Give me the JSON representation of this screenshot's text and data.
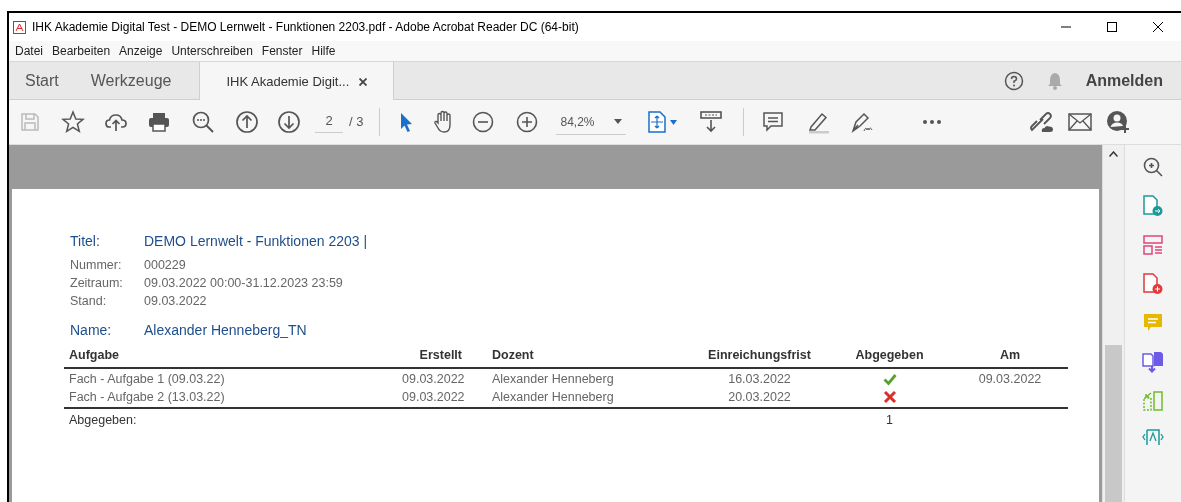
{
  "window": {
    "title": "IHK Akademie Digital Test - DEMO Lernwelt - Funktionen 2203.pdf - Adobe Acrobat Reader DC (64-bit)"
  },
  "menu": [
    "Datei",
    "Bearbeiten",
    "Anzeige",
    "Unterschreiben",
    "Fenster",
    "Hilfe"
  ],
  "tabs": [
    {
      "label": "Start",
      "selected": false,
      "closable": false
    },
    {
      "label": "Werkzeuge",
      "selected": false,
      "closable": false
    },
    {
      "label": "IHK Akademie Digit...",
      "selected": true,
      "closable": true
    }
  ],
  "sign_in": "Anmelden",
  "toolbar": {
    "page_current": "2",
    "page_total": "/ 3",
    "zoom": "84,2%"
  },
  "document": {
    "title_label": "Titel:",
    "title_value": "DEMO Lernwelt - Funktionen 2203 |",
    "fields": [
      {
        "label": "Nummer:",
        "value": "000229"
      },
      {
        "label": "Zeitraum:",
        "value": "09.03.2022 00:00-31.12.2023 23:59"
      },
      {
        "label": "Stand:",
        "value": "09.03.2022"
      }
    ],
    "name_label": "Name:",
    "name_value": "Alexander Henneberg_TN",
    "table": {
      "columns": [
        "Aufgabe",
        "Erstellt",
        "Dozent",
        "Einreichungsfrist",
        "Abgegeben",
        "Am"
      ],
      "rows": [
        {
          "aufgabe": "Fach - Aufgabe 1 (09.03.22)",
          "erstellt": "09.03.2022",
          "dozent": "Alexander Henneberg",
          "frist": "16.03.2022",
          "submitted": true,
          "am": "09.03.2022"
        },
        {
          "aufgabe": "Fach - Aufgabe 2 (13.03.22)",
          "erstellt": "09.03.2022",
          "dozent": "Alexander Henneberg",
          "frist": "20.03.2022",
          "submitted": false
        }
      ],
      "footer_label": "Abgegeben:",
      "footer_count": "1"
    }
  }
}
